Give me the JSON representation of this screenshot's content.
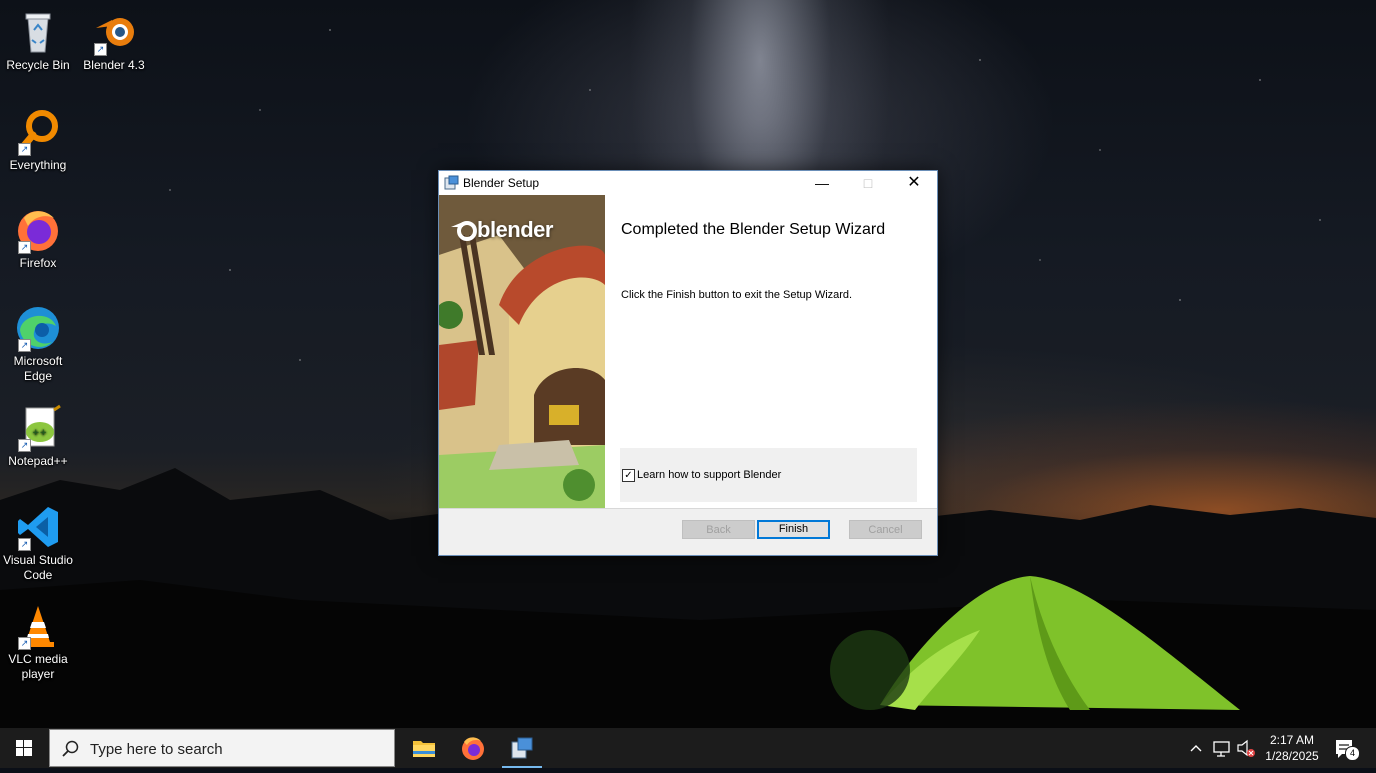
{
  "desktop": {
    "icons": [
      {
        "label": "Recycle Bin"
      },
      {
        "label": "Blender 4.3"
      },
      {
        "label": "Everything"
      },
      {
        "label": "Firefox"
      },
      {
        "label": "Microsoft Edge"
      },
      {
        "label": "Notepad++"
      },
      {
        "label": "Visual Studio Code"
      },
      {
        "label": "VLC media player"
      }
    ]
  },
  "window": {
    "title": "Blender Setup",
    "logo_text": "blender",
    "heading": "Completed the Blender Setup Wizard",
    "body": "Click the Finish button to exit the Setup Wizard.",
    "checkbox": {
      "label": "Learn how to support Blender",
      "checked": true
    },
    "buttons": {
      "back": "Back",
      "finish": "Finish",
      "cancel": "Cancel"
    }
  },
  "taskbar": {
    "search_placeholder": "Type here to search",
    "time": "2:17 AM",
    "date": "1/28/2025",
    "notification_count": "4",
    "pinned": [
      "file-explorer-icon",
      "firefox-icon",
      "blender-setup-icon"
    ]
  },
  "colors": {
    "accent": "#0078d7",
    "taskbar": "#1c1c1c"
  }
}
